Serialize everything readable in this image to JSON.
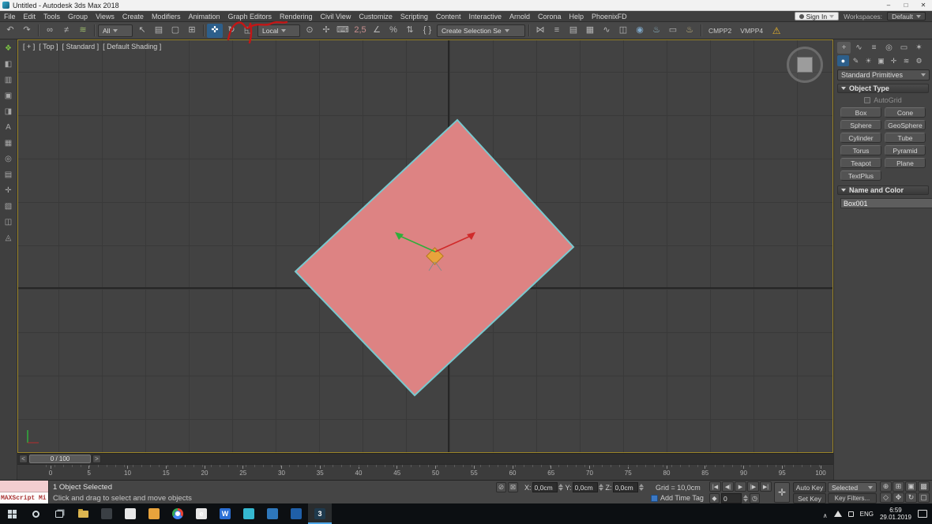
{
  "colors": {
    "object_fill": "#dd8383",
    "object_outline": "#79c9cf",
    "gizmo_x_axis": "#d02a2a",
    "gizmo_y_axis": "#2fae3a",
    "gizmo_plane": "#e8a33c",
    "object_swatch": "#d8453c",
    "annotation": "#c41616"
  },
  "window": {
    "title": "Untitled - Autodesk 3ds Max 2018",
    "minimize": "–",
    "maximize": "□",
    "close": "✕"
  },
  "menu": {
    "items": [
      {
        "name": "menu-file",
        "label": "File"
      },
      {
        "name": "menu-edit",
        "label": "Edit"
      },
      {
        "name": "menu-tools",
        "label": "Tools"
      },
      {
        "name": "menu-group",
        "label": "Group"
      },
      {
        "name": "menu-views",
        "label": "Views"
      },
      {
        "name": "menu-create",
        "label": "Create"
      },
      {
        "name": "menu-modifiers",
        "label": "Modifiers"
      },
      {
        "name": "menu-animation",
        "label": "Animation"
      },
      {
        "name": "menu-graph-editors",
        "label": "Graph Editors"
      },
      {
        "name": "menu-rendering",
        "label": "Rendering"
      },
      {
        "name": "menu-civil-view",
        "label": "Civil View"
      },
      {
        "name": "menu-customize",
        "label": "Customize"
      },
      {
        "name": "menu-scripting",
        "label": "Scripting"
      },
      {
        "name": "menu-content",
        "label": "Content"
      },
      {
        "name": "menu-interactive",
        "label": "Interactive"
      },
      {
        "name": "menu-arnold",
        "label": "Arnold"
      },
      {
        "name": "menu-corona",
        "label": "Corona"
      },
      {
        "name": "menu-help",
        "label": "Help"
      },
      {
        "name": "menu-phoenixfd",
        "label": "PhoenixFD"
      }
    ],
    "sign_in": "Sign In",
    "workspaces_label": "Workspaces:",
    "workspace_value": "Default"
  },
  "toolbar": {
    "history": [
      {
        "name": "undo-icon",
        "glyph": "↶"
      },
      {
        "name": "redo-icon",
        "glyph": "↷"
      }
    ],
    "link_tools": [
      {
        "name": "select-and-link-icon",
        "glyph": "∞"
      },
      {
        "name": "unlink-selection-icon",
        "glyph": "≠"
      },
      {
        "name": "bind-to-spacewarp-icon",
        "glyph": "≋",
        "color": "#9ab86a"
      }
    ],
    "selection_filter": "All",
    "select_tools": [
      {
        "name": "select-object-icon",
        "glyph": "↖"
      },
      {
        "name": "select-by-name-icon",
        "glyph": "▤"
      },
      {
        "name": "rectangular-selection-icon",
        "glyph": "▢"
      },
      {
        "name": "window-crossing-icon",
        "glyph": "⊞"
      }
    ],
    "transform_tools": [
      {
        "name": "select-and-move-icon",
        "glyph": "✜",
        "active": true
      },
      {
        "name": "select-and-rotate-icon",
        "glyph": "↻"
      },
      {
        "name": "select-and-scale-icon",
        "glyph": "◱"
      }
    ],
    "coord_system": "Local",
    "pivot_tools": [
      {
        "name": "use-pivot-center-icon",
        "glyph": "⊙"
      },
      {
        "name": "select-and-manipulate-icon",
        "glyph": "✢"
      },
      {
        "name": "keyboard-override-icon",
        "glyph": "⌨"
      }
    ],
    "snap_tools": [
      {
        "name": "snap-toggle-icon",
        "glyph": "2,5",
        "color": "#c98f8f"
      },
      {
        "name": "angle-snap-icon",
        "glyph": "∠"
      },
      {
        "name": "percent-snap-icon",
        "glyph": "%"
      },
      {
        "name": "spinner-snap-icon",
        "glyph": "⇅"
      }
    ],
    "named_sets_icon": "{ }",
    "named_selection": "Create Selection Se",
    "utility_tools": [
      {
        "name": "mirror-icon",
        "glyph": "⋈"
      },
      {
        "name": "align-icon",
        "glyph": "≡"
      },
      {
        "name": "layer-manager-icon",
        "glyph": "▤"
      },
      {
        "name": "scene-explorer-icon",
        "glyph": "▦"
      },
      {
        "name": "curve-editor-icon",
        "glyph": "∿"
      },
      {
        "name": "schematic-view-icon",
        "glyph": "◫"
      },
      {
        "name": "material-editor-icon",
        "glyph": "◉",
        "color": "#7fa8c9"
      },
      {
        "name": "render-setup-icon",
        "glyph": "♨",
        "color": "#8fb8c9"
      },
      {
        "name": "rendered-frame-icon",
        "glyph": "▭"
      },
      {
        "name": "render-production-icon",
        "glyph": "♨",
        "color": "#c9b87f"
      }
    ],
    "plugin_buttons": [
      {
        "name": "cmpp2-button",
        "label": "CMPP2"
      },
      {
        "name": "vmpp4-button",
        "label": "VMPP4"
      }
    ],
    "warning_icon": "⚠",
    "warning_color": "#e8b32a"
  },
  "left_toolbar": {
    "icons": [
      {
        "name": "left-toolbar-icon-1",
        "glyph": "❖",
        "color": "#7ac143"
      },
      {
        "name": "left-toolbar-icon-2",
        "glyph": "◧"
      },
      {
        "name": "left-toolbar-icon-3",
        "glyph": "▥"
      },
      {
        "name": "left-toolbar-icon-4",
        "glyph": "▣"
      },
      {
        "name": "left-toolbar-icon-5",
        "glyph": "◨"
      },
      {
        "name": "left-toolbar-icon-6",
        "glyph": "A"
      },
      {
        "name": "left-toolbar-icon-7",
        "glyph": "▦"
      },
      {
        "name": "left-toolbar-icon-8",
        "glyph": "◎"
      },
      {
        "name": "left-toolbar-icon-9",
        "glyph": "▤"
      },
      {
        "name": "left-toolbar-icon-10",
        "glyph": "✛"
      },
      {
        "name": "left-toolbar-icon-11",
        "glyph": "▧"
      },
      {
        "name": "left-toolbar-icon-12",
        "glyph": "◫"
      },
      {
        "name": "left-toolbar-icon-13",
        "glyph": "◬"
      }
    ]
  },
  "viewport": {
    "menus": [
      {
        "name": "viewport-general-menu",
        "label": "[ + ]"
      },
      {
        "name": "viewport-pov-menu",
        "label": "[ Top ]"
      },
      {
        "name": "viewport-renderer-menu",
        "label": "[ Standard ]"
      },
      {
        "name": "viewport-shading-menu",
        "label": "[ Default Shading ]"
      }
    ]
  },
  "command_panel": {
    "tabs": [
      {
        "name": "create-tab",
        "glyph": "+",
        "active": true
      },
      {
        "name": "modify-tab",
        "glyph": "∿"
      },
      {
        "name": "hierarchy-tab",
        "glyph": "≡"
      },
      {
        "name": "motion-tab",
        "glyph": "◎"
      },
      {
        "name": "display-tab",
        "glyph": "▭"
      },
      {
        "name": "utilities-tab",
        "glyph": "✶"
      }
    ],
    "categories": [
      {
        "name": "geometry-category",
        "glyph": "●",
        "active": true
      },
      {
        "name": "shapes-category",
        "glyph": "✎"
      },
      {
        "name": "lights-category",
        "glyph": "☀"
      },
      {
        "name": "cameras-category",
        "glyph": "▣"
      },
      {
        "name": "helpers-category",
        "glyph": "✛"
      },
      {
        "name": "spacewarps-category",
        "glyph": "≋"
      },
      {
        "name": "systems-category",
        "glyph": "⚙"
      }
    ],
    "primitives_dropdown": "Standard Primitives",
    "object_type_label": "Object Type",
    "autogrid_label": "AutoGrid",
    "primitive_buttons": [
      {
        "name": "box-button",
        "label": "Box"
      },
      {
        "name": "cone-button",
        "label": "Cone"
      },
      {
        "name": "sphere-button",
        "label": "Sphere"
      },
      {
        "name": "geosphere-button",
        "label": "GeoSphere"
      },
      {
        "name": "cylinder-button",
        "label": "Cylinder"
      },
      {
        "name": "tube-button",
        "label": "Tube"
      },
      {
        "name": "torus-button",
        "label": "Torus"
      },
      {
        "name": "pyramid-button",
        "label": "Pyramid"
      },
      {
        "name": "teapot-button",
        "label": "Teapot"
      },
      {
        "name": "plane-button",
        "label": "Plane"
      },
      {
        "name": "textplus-button",
        "label": "TextPlus"
      }
    ],
    "name_color_label": "Name and Color",
    "object_name": "Box001"
  },
  "timeline": {
    "prev": "<",
    "next": ">",
    "slider_label": "0 / 100",
    "ticks": [
      "0",
      "5",
      "10",
      "15",
      "20",
      "25",
      "30",
      "35",
      "40",
      "45",
      "50",
      "55",
      "60",
      "65",
      "70",
      "75",
      "80",
      "85",
      "90",
      "95",
      "100"
    ]
  },
  "status": {
    "maxscript_label": "MAXScript Mi",
    "selection_text": "1 Object Selected",
    "prompt_text": "Click and drag to select and move objects",
    "toggles": [
      {
        "name": "isolate-selection-toggle",
        "glyph": "⊘"
      },
      {
        "name": "selection-lock-toggle",
        "glyph": "⊠"
      }
    ],
    "coords": [
      {
        "name": "x-coordinate-field",
        "label": "X:",
        "value": "0,0cm"
      },
      {
        "name": "y-coordinate-field",
        "label": "Y:",
        "value": "0,0cm"
      },
      {
        "name": "z-coordinate-field",
        "label": "Z:",
        "value": "0,0cm"
      }
    ],
    "grid_text": "Grid = 10,0cm",
    "add_time_tag": "Add Time Tag",
    "playback": [
      {
        "name": "go-to-start-button",
        "glyph": "|◀"
      },
      {
        "name": "previous-frame-button",
        "glyph": "◀|"
      },
      {
        "name": "play-button",
        "glyph": "▶"
      },
      {
        "name": "next-frame-button",
        "glyph": "|▶"
      },
      {
        "name": "go-to-end-button",
        "glyph": "▶|"
      }
    ],
    "key_toggle_glyph": "◆",
    "frame_value": "0",
    "time_config_glyph": "◷",
    "offset_mode_glyph": "✛",
    "auto_key": "Auto Key",
    "selected_filter": "Selected",
    "set_key": "Set Key",
    "key_filters": "Key Filters...",
    "nav": [
      {
        "name": "zoom-icon",
        "glyph": "⊕"
      },
      {
        "name": "zoom-all-icon",
        "glyph": "⊞"
      },
      {
        "name": "zoom-extents-icon",
        "glyph": "▣"
      },
      {
        "name": "zoom-extents-all-icon",
        "glyph": "▩"
      },
      {
        "name": "fov-icon",
        "glyph": "◇"
      },
      {
        "name": "pan-icon",
        "glyph": "✥"
      },
      {
        "name": "orbit-icon",
        "glyph": "↻"
      },
      {
        "name": "maximize-viewport-icon",
        "glyph": "▢"
      }
    ]
  },
  "taskbar": {
    "apps": [
      {
        "name": "taskbar-app-1",
        "color": "#3a3f44"
      },
      {
        "name": "taskbar-app-2",
        "color": "#e8e8e8"
      },
      {
        "name": "taskbar-app-3",
        "color": "#e8a33c"
      },
      {
        "name": "taskbar-app-chrome"
      },
      {
        "name": "taskbar-app-5",
        "color": "#e8e8e8",
        "glyph": "e"
      },
      {
        "name": "taskbar-app-6",
        "color": "#2b6fd4",
        "glyph": "W"
      },
      {
        "name": "taskbar-app-7",
        "color": "#35b8d0"
      },
      {
        "name": "taskbar-app-8",
        "color": "#2e77bb"
      },
      {
        "name": "taskbar-app-9",
        "color": "#1f5fa8"
      },
      {
        "name": "taskbar-app-3dsmax",
        "color": "#1f3a4d",
        "glyph": "3",
        "active": true
      }
    ],
    "tray": {
      "chevron": "∧",
      "lang": "ENG",
      "time": "6:59",
      "date": "29.01.2019"
    }
  }
}
